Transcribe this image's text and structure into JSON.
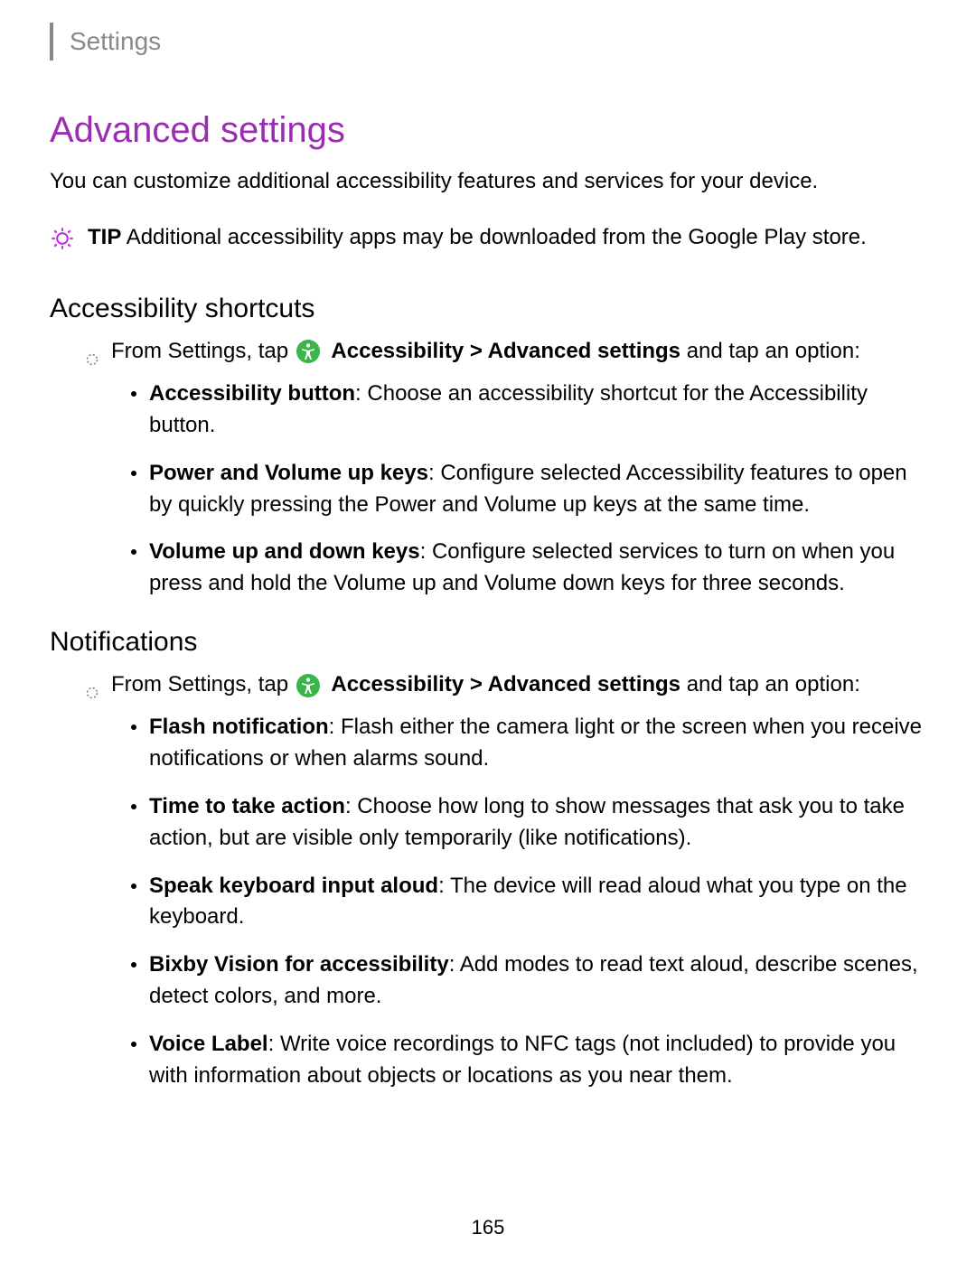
{
  "header": {
    "breadcrumb": "Settings"
  },
  "page": {
    "title": "Advanced settings",
    "intro": "You can customize additional accessibility features and services for your device.",
    "tip_label": "TIP",
    "tip_text": "Additional accessibility apps may be downloaded from the Google Play store."
  },
  "sections": [
    {
      "title": "Accessibility shortcuts",
      "instruction_prefix": "From Settings, tap ",
      "instruction_path_1": "Accessibility",
      "instruction_sep": " > ",
      "instruction_path_2": "Advanced settings",
      "instruction_suffix": " and tap an option:",
      "items": [
        {
          "label": "Accessibility button",
          "desc": ": Choose an accessibility shortcut for the Accessibility button."
        },
        {
          "label": "Power and Volume up keys",
          "desc": ": Configure selected Accessibility features to open by quickly pressing the Power and Volume up keys at the same time."
        },
        {
          "label": "Volume up and down keys",
          "desc": ": Configure selected services to turn on when you press and hold the Volume up and Volume down keys for three seconds."
        }
      ]
    },
    {
      "title": "Notifications",
      "instruction_prefix": "From Settings, tap ",
      "instruction_path_1": "Accessibility",
      "instruction_sep": " > ",
      "instruction_path_2": "Advanced settings",
      "instruction_suffix": " and tap an option:",
      "items": [
        {
          "label": "Flash notification",
          "desc": ": Flash either the camera light or the screen when you receive notifications or when alarms sound."
        },
        {
          "label": "Time to take action",
          "desc": ": Choose how long to show messages that ask you to take action, but are visible only temporarily (like notifications)."
        },
        {
          "label": "Speak keyboard input aloud",
          "desc": ": The device will read aloud what you type on the keyboard."
        },
        {
          "label": "Bixby Vision for accessibility",
          "desc": ": Add modes to read text aloud, describe scenes, detect colors, and more."
        },
        {
          "label": "Voice Label",
          "desc": ": Write voice recordings to NFC tags (not included) to provide you with information about objects or locations as you near them."
        }
      ]
    }
  ],
  "page_number": "165"
}
